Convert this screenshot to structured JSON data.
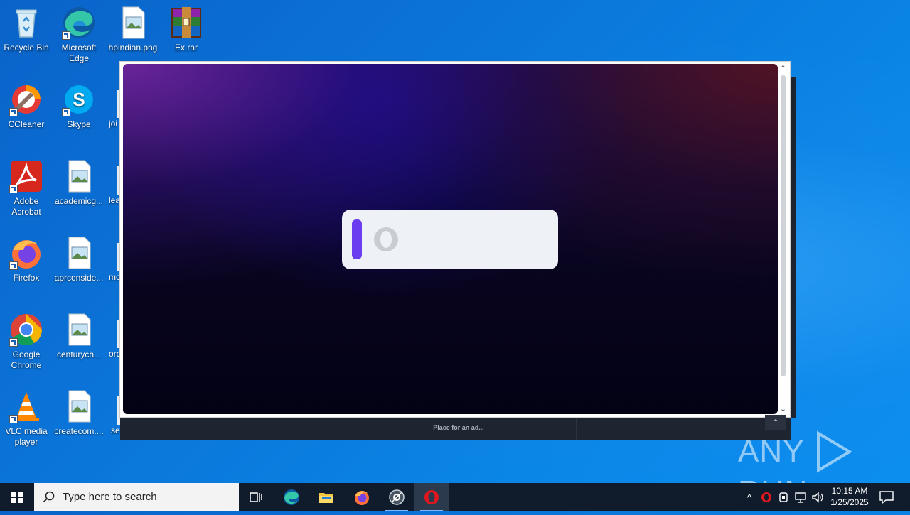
{
  "desktop": {
    "icons": [
      {
        "label": "Recycle Bin",
        "icon": "recycle-bin-icon"
      },
      {
        "label": "Microsoft Edge",
        "icon": "edge-icon"
      },
      {
        "label": "hpindian.png",
        "icon": "image-file-icon"
      },
      {
        "label": "Ex.rar",
        "icon": "winrar-archive-icon"
      },
      {
        "label": "CCleaner",
        "icon": "ccleaner-icon"
      },
      {
        "label": "Skype",
        "icon": "skype-icon"
      },
      {
        "label": "Adobe Acrobat",
        "icon": "acrobat-icon"
      },
      {
        "label": "academicg...",
        "icon": "image-file-icon"
      },
      {
        "label": "Firefox",
        "icon": "firefox-icon"
      },
      {
        "label": "aprconside...",
        "icon": "image-file-icon"
      },
      {
        "label": "Google Chrome",
        "icon": "chrome-icon"
      },
      {
        "label": "centurych...",
        "icon": "image-file-icon"
      },
      {
        "label": "VLC media player",
        "icon": "vlc-icon"
      },
      {
        "label": "createcom....",
        "icon": "image-file-icon"
      }
    ],
    "clipped_labels": [
      "joi",
      "lea",
      "mc",
      "ord",
      "se"
    ]
  },
  "popup": {
    "ad_text": "Place for an ad...",
    "collapse_glyph": "⌃",
    "scroll_up": "⌃",
    "scroll_down": "⌄"
  },
  "watermark": {
    "left": "ANY",
    "right": "RUN"
  },
  "taskbar": {
    "search_placeholder": "Type here to search",
    "time": "10:15 AM",
    "date": "1/25/2025"
  },
  "colors": {
    "taskbar": "#101c2c",
    "loader_accent": "#6a3df0",
    "desktop_blue": "#0b74d8"
  }
}
